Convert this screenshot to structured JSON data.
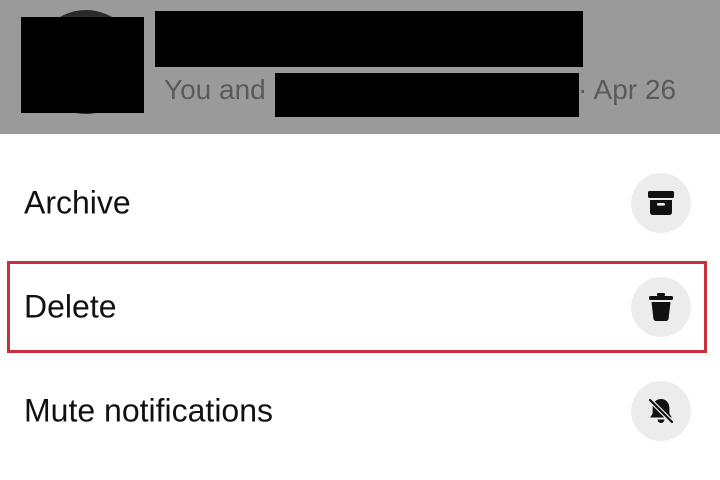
{
  "header": {
    "subtitle_prefix": "You and",
    "subtitle_date": "· Apr 26"
  },
  "menu": {
    "items": [
      {
        "label": "Archive",
        "icon": "archive-icon"
      },
      {
        "label": "Delete",
        "icon": "trash-icon"
      },
      {
        "label": "Mute notifications",
        "icon": "bell-muted-icon"
      }
    ],
    "highlighted_item": "Delete"
  },
  "colors": {
    "header_overlay": "#9a9a9a",
    "highlight_border": "#c8303a",
    "icon_background": "#ececec"
  }
}
